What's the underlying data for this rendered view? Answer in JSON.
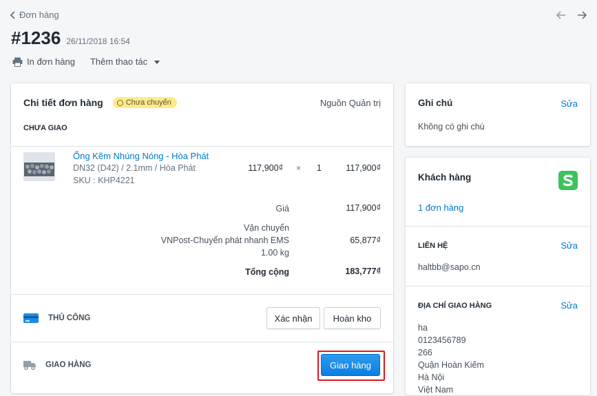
{
  "nav": {
    "back_label": "Đơn hàng"
  },
  "order": {
    "number": "#1236",
    "date": "26/11/2018 16:54"
  },
  "actions": {
    "print_label": "In đơn hàng",
    "more_label": "Thêm thao tác"
  },
  "details": {
    "title": "Chi tiết đơn hàng",
    "status_badge": "Chưa chuyển",
    "source_label": "Nguồn",
    "source_value": "Quản trị",
    "section_label": "CHƯA GIAO",
    "item": {
      "name": "Ống Kẽm Nhúng Nóng - Hòa Phát",
      "variant": "DN32 (D42) / 2.1mm / Hòa Phát",
      "sku": "SKU : KHP4221",
      "price": "117,900₫",
      "times": "×",
      "qty": "1",
      "total": "117,900₫"
    },
    "summary": {
      "price_label": "Giá",
      "price_value": "117,900₫",
      "shipping_label": "Vận chuyển",
      "shipping_method": "VNPost-Chuyển phát nhanh EMS",
      "shipping_weight": "1.00 kg",
      "shipping_value": "65,877₫",
      "total_label": "Tổng cộng",
      "total_value": "183,777₫"
    },
    "payment": {
      "label": "THỦ CÔNG",
      "confirm_button": "Xác nhận",
      "refund_button": "Hoàn kho"
    },
    "fulfillment": {
      "label": "GIAO HÀNG",
      "ship_button": "Giao hàng"
    }
  },
  "notes": {
    "title": "Ghi chú",
    "edit_label": "Sửa",
    "text": "Không có ghi chú"
  },
  "customer": {
    "title": "Khách hàng",
    "orders_link": "1 đơn hàng",
    "contact_label": "LIÊN HỆ",
    "contact_edit": "Sửa",
    "email": "haltbb@sapo.cn",
    "address_label": "ĐỊA CHỈ GIAO HÀNG",
    "address_edit": "Sửa",
    "address_lines": [
      "ha",
      "0123456789",
      "266",
      "Quận Hoàn Kiếm",
      "Hà Nội",
      "Việt Nam"
    ]
  },
  "colors": {
    "accent": "#007ace",
    "primary_button": "#1b8be6",
    "badge_bg": "#ffea8a",
    "highlight": "#e0161c",
    "logo_green": "#3bc45c"
  }
}
